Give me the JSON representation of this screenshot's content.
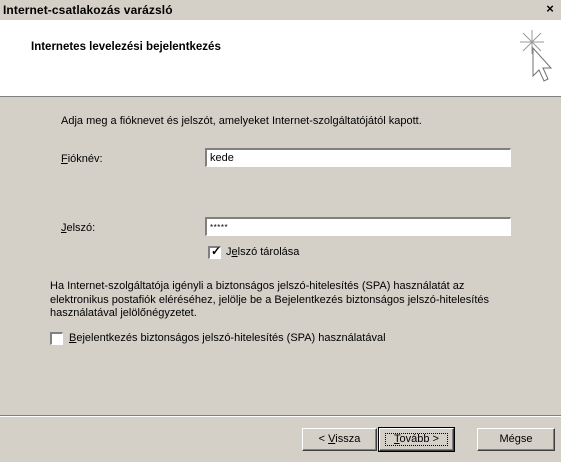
{
  "window": {
    "title": "Internet-csatlakozás varázsló",
    "close_glyph": "×"
  },
  "header": {
    "title": "Internetes levelezési bejelentkezés",
    "icon": "wizard-sparkle-cursor-icon"
  },
  "form": {
    "instruction": "Adja meg a fióknevet és jelszót, amelyeket Internet-szolgáltatójától kapott.",
    "account": {
      "label_hotkey": "F",
      "label_rest": "ióknév:",
      "value": "kede"
    },
    "password": {
      "label_hotkey": "J",
      "label_rest": "elszó:",
      "value": "*****"
    },
    "remember": {
      "checked": true,
      "label_pre": "J",
      "label_hotkey": "e",
      "label_rest": "lszó tárolása"
    },
    "spa_info": "Ha Internet-szolgáltatója igényli a biztonságos jelszó-hitelesítés (SPA) használatát az elektronikus postafiók eléréséhez, jelölje be a Bejelentkezés biztonságos jelszó-hitelesítés használatával jelölőnégyzetet.",
    "spa_checkbox": {
      "checked": false,
      "label_hotkey": "B",
      "label_rest": "ejelentkezés biztonságos jelszó-hitelesítés (SPA) használatával"
    }
  },
  "buttons": {
    "back_pre": "< ",
    "back_hotkey": "V",
    "back_rest": "issza",
    "next_hotkey": "T",
    "next_rest": "ovább >",
    "cancel": "Mégse"
  }
}
